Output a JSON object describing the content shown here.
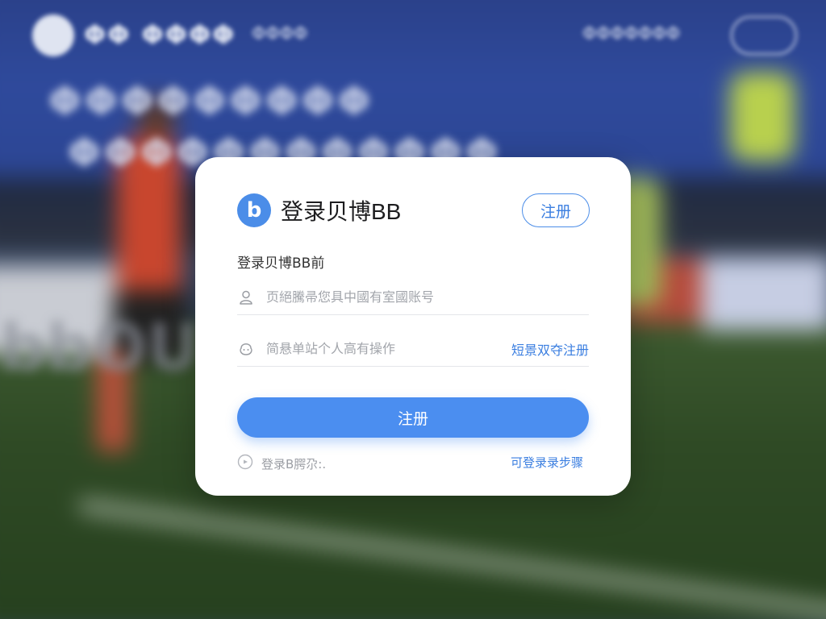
{
  "background": {
    "logo_text": "ΦΦ ΦΦΦΦ",
    "sub_text": "ΦΦΦΦ",
    "nav_text": "ΦΦΦΦΦΦΦ",
    "headline_1": "ΦΦΦΦΦΦΦΦΦ",
    "headline_2": "ΦΦΦΦΦΦΦΦΦΦΦΦ",
    "watermark": "bbOU"
  },
  "card": {
    "brand_letter": "b",
    "brand_title": "登录贝博BB",
    "register_pill": "注册",
    "subtitle": "登录贝博BB前",
    "account_placeholder": "页絕騰帚您具中國有室國账号",
    "password_placeholder": "简悬单站个人高有操作",
    "password_link": "短景双夺注册",
    "submit_label": "注册",
    "footer_left": "登录B腭尕:.",
    "footer_right": "可登录录步骤"
  },
  "colors": {
    "accent": "#4b8ef0",
    "link": "#3a7ee0"
  }
}
